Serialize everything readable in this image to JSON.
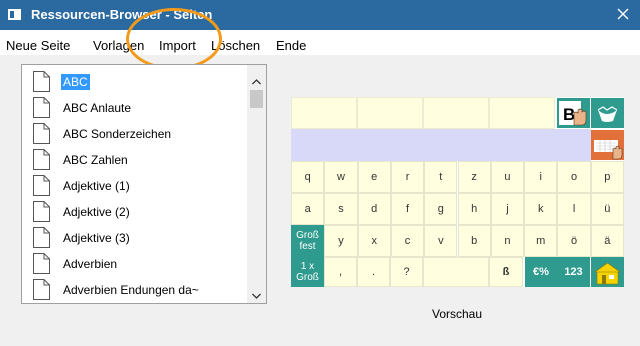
{
  "window": {
    "title": "Ressourcen-Browser - Seiten",
    "close_label": "close"
  },
  "menu": [
    "Neue Seite",
    "Vorlagen",
    "Import",
    "Löschen",
    "Ende"
  ],
  "list": {
    "items": [
      "ABC",
      "ABC Anlaute",
      "ABC Sonderzeichen",
      "ABC Zahlen",
      "Adjektive (1)",
      "Adjektive (2)",
      "Adjektive (3)",
      "Adverbien",
      "Adverbien Endungen da~"
    ],
    "selected_index": 0
  },
  "preview": {
    "label": "Vorschau",
    "rows": {
      "row1": [
        "q",
        "w",
        "e",
        "r",
        "t",
        "z",
        "u",
        "i",
        "o",
        "p"
      ],
      "row2": [
        "a",
        "s",
        "d",
        "f",
        "g",
        "h",
        "j",
        "k",
        "l",
        "ü"
      ],
      "row3_left": "Groß fest",
      "row3": [
        "y",
        "x",
        "c",
        "v",
        "b",
        "n",
        "m",
        "ö",
        "ä"
      ],
      "row4_left": "1 x Groß",
      "row4_keys": [
        ",",
        ".",
        "?"
      ],
      "row4_right": [
        "ß"
      ],
      "euro_key": "€%",
      "num_key": "123"
    }
  },
  "colors": {
    "titlebar": "#2a6aa0",
    "selection": "#3399ff",
    "key_bg": "#ffffe0",
    "band_bg": "#d8d8f8",
    "teal": "#2e9b8e",
    "annotation": "#f29a1a"
  },
  "icons": [
    "app-icon",
    "close-icon",
    "document-icon",
    "scroll-up-arrow-icon",
    "scroll-down-arrow-icon",
    "hand-pointer-icon",
    "keyboard-icon",
    "house-icon"
  ]
}
